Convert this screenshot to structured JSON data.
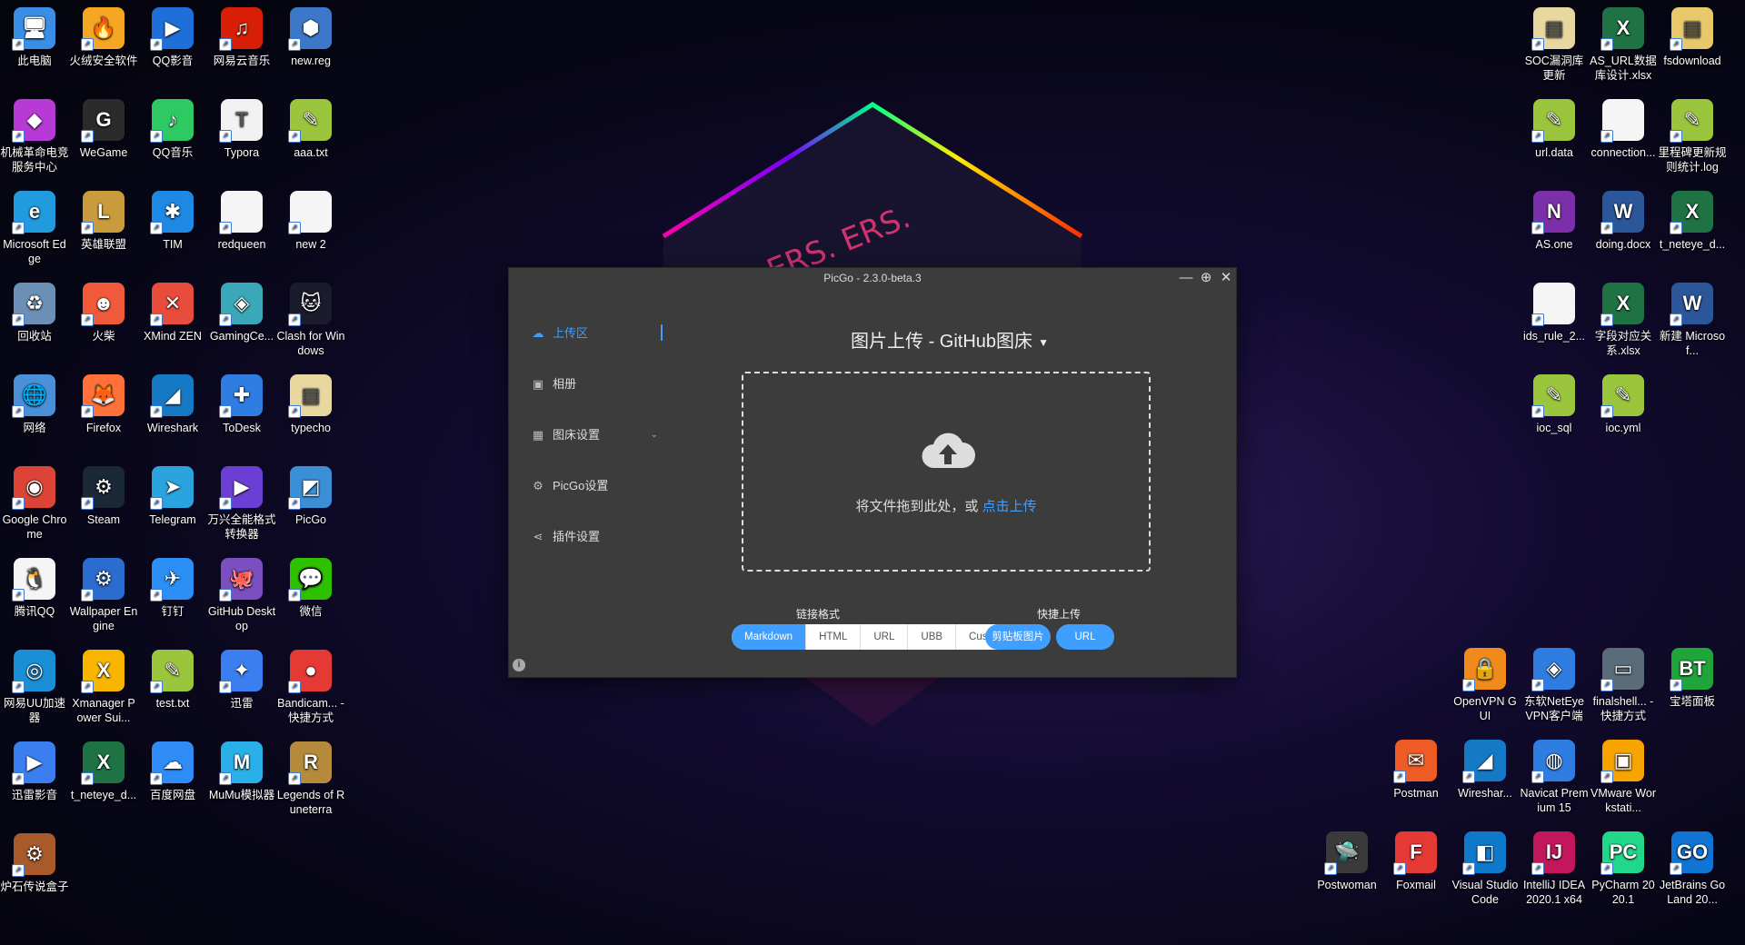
{
  "desktop": {
    "left_icons": [
      {
        "label": "此电脑",
        "color": "#3a8ee6",
        "glyph": "🖥",
        "icon": "computer-icon"
      },
      {
        "label": "火绒安全软件",
        "color": "#f5a623",
        "glyph": "🔥",
        "icon": "huorong-icon"
      },
      {
        "label": "QQ影音",
        "color": "#1e6fd9",
        "glyph": "▶",
        "icon": "qq-player-icon"
      },
      {
        "label": "网易云音乐",
        "color": "#d81e06",
        "glyph": "♫",
        "icon": "netease-music-icon"
      },
      {
        "label": "new.reg",
        "color": "#3d77c7",
        "glyph": "⬢",
        "icon": "registry-file-icon"
      },
      {
        "label": "机械革命电竞服务中心",
        "color": "#b83ad6",
        "glyph": "◆",
        "icon": "mechrevo-icon"
      },
      {
        "label": "WeGame",
        "color": "#2b2b2b",
        "glyph": "G",
        "icon": "wegame-icon"
      },
      {
        "label": "QQ音乐",
        "color": "#2ec963",
        "glyph": "♪",
        "icon": "qq-music-icon"
      },
      {
        "label": "Typora",
        "color": "#f2f2f2",
        "glyph": "T",
        "icon": "typora-icon"
      },
      {
        "label": "aaa.txt",
        "color": "#9bc53d",
        "glyph": "✎",
        "icon": "notepad-icon"
      },
      {
        "label": "Microsoft Edge",
        "color": "#1f9bde",
        "glyph": "e",
        "icon": "edge-icon"
      },
      {
        "label": "英雄联盟",
        "color": "#c89b3c",
        "glyph": "L",
        "icon": "lol-icon"
      },
      {
        "label": "TIM",
        "color": "#1e88e5",
        "glyph": "✱",
        "icon": "tim-icon"
      },
      {
        "label": "redqueen",
        "color": "#f5f5f5",
        "glyph": "",
        "icon": "file-icon"
      },
      {
        "label": "new 2",
        "color": "#f5f5f5",
        "glyph": "",
        "icon": "file-icon"
      },
      {
        "label": "回收站",
        "color": "#6b8fb5",
        "glyph": "♻",
        "icon": "recycle-bin-icon"
      },
      {
        "label": "火柴",
        "color": "#f05a3a",
        "glyph": "☻",
        "icon": "huochai-icon"
      },
      {
        "label": "XMind ZEN",
        "color": "#e84c3d",
        "glyph": "✕",
        "icon": "xmind-icon"
      },
      {
        "label": "GamingCe...",
        "color": "#3aa8b8",
        "glyph": "◈",
        "icon": "gaming-center-icon"
      },
      {
        "label": "Clash for Windows",
        "color": "#1b1b2e",
        "glyph": "🐱",
        "icon": "clash-icon"
      },
      {
        "label": "网络",
        "color": "#4a90d9",
        "glyph": "🌐",
        "icon": "network-icon"
      },
      {
        "label": "Firefox",
        "color": "#ff7139",
        "glyph": "🦊",
        "icon": "firefox-icon"
      },
      {
        "label": "Wireshark",
        "color": "#1679c6",
        "glyph": "◢",
        "icon": "wireshark-icon"
      },
      {
        "label": "ToDesk",
        "color": "#2f7de1",
        "glyph": "✚",
        "icon": "todesk-icon"
      },
      {
        "label": "typecho",
        "color": "#e8d8a0",
        "glyph": "▤",
        "icon": "typecho-folder-icon"
      },
      {
        "label": "Google Chrome",
        "color": "#db4437",
        "glyph": "◉",
        "icon": "chrome-icon"
      },
      {
        "label": "Steam",
        "color": "#1b2838",
        "glyph": "⚙",
        "icon": "steam-icon"
      },
      {
        "label": "Telegram",
        "color": "#2aa3de",
        "glyph": "➤",
        "icon": "telegram-icon"
      },
      {
        "label": "万兴全能格式转换器",
        "color": "#6b3fd4",
        "glyph": "▶",
        "icon": "uniconverter-icon"
      },
      {
        "label": "PicGo",
        "color": "#3a8fd6",
        "glyph": "◩",
        "icon": "picgo-icon"
      },
      {
        "label": "腾讯QQ",
        "color": "#f5f5f5",
        "glyph": "🐧",
        "icon": "qq-icon"
      },
      {
        "label": "Wallpaper Engine",
        "color": "#2b6ccf",
        "glyph": "⚙",
        "icon": "wallpaper-engine-icon"
      },
      {
        "label": "钉钉",
        "color": "#2b8ff5",
        "glyph": "✈",
        "icon": "dingtalk-icon"
      },
      {
        "label": "GitHub Desktop",
        "color": "#7b4fbf",
        "glyph": "🐙",
        "icon": "github-desktop-icon"
      },
      {
        "label": "微信",
        "color": "#2dc100",
        "glyph": "💬",
        "icon": "wechat-icon"
      },
      {
        "label": "网易UU加速器",
        "color": "#1a8fd6",
        "glyph": "◎",
        "icon": "uu-booster-icon"
      },
      {
        "label": "Xmanager Power Sui...",
        "color": "#f7b500",
        "glyph": "X",
        "icon": "xmanager-icon"
      },
      {
        "label": "test.txt",
        "color": "#9bc53d",
        "glyph": "✎",
        "icon": "notepad-icon"
      },
      {
        "label": "迅雷",
        "color": "#3b7ef0",
        "glyph": "✦",
        "icon": "thunder-icon"
      },
      {
        "label": "Bandicam... - 快捷方式",
        "color": "#e53935",
        "glyph": "●",
        "icon": "bandicam-icon"
      },
      {
        "label": "迅雷影音",
        "color": "#3b7ef0",
        "glyph": "▶",
        "icon": "thunder-player-icon"
      },
      {
        "label": "t_neteye_d...",
        "color": "#1f7244",
        "glyph": "X",
        "icon": "excel-file-icon"
      },
      {
        "label": "百度网盘",
        "color": "#2f8cf7",
        "glyph": "☁",
        "icon": "baidu-netdisk-icon"
      },
      {
        "label": "MuMu模拟器",
        "color": "#2ab0e8",
        "glyph": "M",
        "icon": "mumu-icon"
      },
      {
        "label": "Legends of Runeterra",
        "color": "#b58a3a",
        "glyph": "R",
        "icon": "runeterra-icon"
      },
      {
        "label": "炉石传说盒子",
        "color": "#a85a2a",
        "glyph": "⚙",
        "icon": "hearthstone-box-icon"
      }
    ],
    "right_icons": [
      {
        "label": "SOC漏洞库更新",
        "color": "#e8d8a0",
        "glyph": "▤",
        "icon": "folder-icon"
      },
      {
        "label": "AS_URL数据库设计.xlsx",
        "color": "#1f7244",
        "glyph": "X",
        "icon": "excel-file-icon"
      },
      {
        "label": "fsdownload",
        "color": "#e8c86a",
        "glyph": "▤",
        "icon": "folder-icon"
      },
      {
        "label": "url.data",
        "color": "#9bc53d",
        "glyph": "✎",
        "icon": "notepad-icon"
      },
      {
        "label": "connection...",
        "color": "#f5f5f5",
        "glyph": "",
        "icon": "file-icon"
      },
      {
        "label": "里程碑更新规则统计.log",
        "color": "#9bc53d",
        "glyph": "✎",
        "icon": "notepad-icon"
      },
      {
        "label": "AS.one",
        "color": "#7b2fa8",
        "glyph": "N",
        "icon": "onenote-file-icon"
      },
      {
        "label": "doing.docx",
        "color": "#2b579a",
        "glyph": "W",
        "icon": "word-file-icon"
      },
      {
        "label": "t_neteye_d...",
        "color": "#1f7244",
        "glyph": "X",
        "icon": "excel-file-icon"
      },
      {
        "label": "ids_rule_2...",
        "color": "#f5f5f5",
        "glyph": "",
        "icon": "file-icon"
      },
      {
        "label": "字段对应关系.xlsx",
        "color": "#1f7244",
        "glyph": "X",
        "icon": "excel-file-icon"
      },
      {
        "label": "新建 Microsof...",
        "color": "#2b579a",
        "glyph": "W",
        "icon": "word-file-icon"
      },
      {
        "label": "ioc_sql",
        "color": "#9bc53d",
        "glyph": "✎",
        "icon": "notepad-icon"
      },
      {
        "label": "ioc.yml",
        "color": "#9bc53d",
        "glyph": "✎",
        "icon": "notepad-icon"
      }
    ],
    "bottom_right_icons": [
      {
        "label": "OpenVPN GUI",
        "color": "#f08a1c",
        "glyph": "🔒",
        "icon": "openvpn-icon"
      },
      {
        "label": "东软NetEye VPN客户端",
        "color": "#2f7de1",
        "glyph": "◈",
        "icon": "neteye-vpn-icon"
      },
      {
        "label": "finalshell... - 快捷方式",
        "color": "#5a6b7a",
        "glyph": "▭",
        "icon": "finalshell-icon"
      },
      {
        "label": "宝塔面板",
        "color": "#20a53a",
        "glyph": "BT",
        "icon": "baota-icon"
      },
      {
        "label": "Postman",
        "color": "#ef5b25",
        "glyph": "✉",
        "icon": "postman-icon"
      },
      {
        "label": "Wireshar...",
        "color": "#1679c6",
        "glyph": "◢",
        "icon": "wireshark-icon"
      },
      {
        "label": "Navicat Premium 15",
        "color": "#2f7de1",
        "glyph": "◍",
        "icon": "navicat-icon"
      },
      {
        "label": "VMware Workstati...",
        "color": "#f7a300",
        "glyph": "▣",
        "icon": "vmware-icon"
      },
      {
        "label": "Postwoman",
        "color": "#3a3a3a",
        "glyph": "🛸",
        "icon": "postwoman-icon"
      },
      {
        "label": "Foxmail",
        "color": "#e53935",
        "glyph": "F",
        "icon": "foxmail-icon"
      },
      {
        "label": "Visual Studio Code",
        "color": "#0f7acc",
        "glyph": "◧",
        "icon": "vscode-icon"
      },
      {
        "label": "IntelliJ IDEA 2020.1 x64",
        "color": "#c2185b",
        "glyph": "IJ",
        "icon": "intellij-icon"
      },
      {
        "label": "PyCharm 2020.1",
        "color": "#21d789",
        "glyph": "PC",
        "icon": "pycharm-icon"
      },
      {
        "label": "JetBrains GoLand 20...",
        "color": "#0f74d3",
        "glyph": "GO",
        "icon": "goland-icon"
      }
    ]
  },
  "picgo": {
    "window_title": "PicGo - 2.3.0-beta.3",
    "controls": {
      "minimize": "—",
      "pin": "⊕",
      "close": "✕"
    },
    "nav": [
      {
        "label": "上传区",
        "glyph": "☁",
        "active": true
      },
      {
        "label": "相册",
        "glyph": "▣",
        "active": false
      },
      {
        "label": "图床设置",
        "glyph": "▦",
        "active": false,
        "chevron": "⌄"
      },
      {
        "label": "PicGo设置",
        "glyph": "⚙",
        "active": false
      },
      {
        "label": "插件设置",
        "glyph": "⋖",
        "active": false
      }
    ],
    "title": "图片上传 - GitHub图床",
    "title_caret": "▼",
    "drop_text": "将文件拖到此处，或 ",
    "drop_link": "点击上传",
    "link_format_label": "链接格式",
    "link_formats": [
      "Markdown",
      "HTML",
      "URL",
      "UBB",
      "Custom"
    ],
    "active_format": "Markdown",
    "quick_upload_label": "快捷上传",
    "quick_clipboard": "剪贴板图片",
    "quick_url": "URL",
    "info_glyph": "i",
    "accent": "#409eff"
  }
}
